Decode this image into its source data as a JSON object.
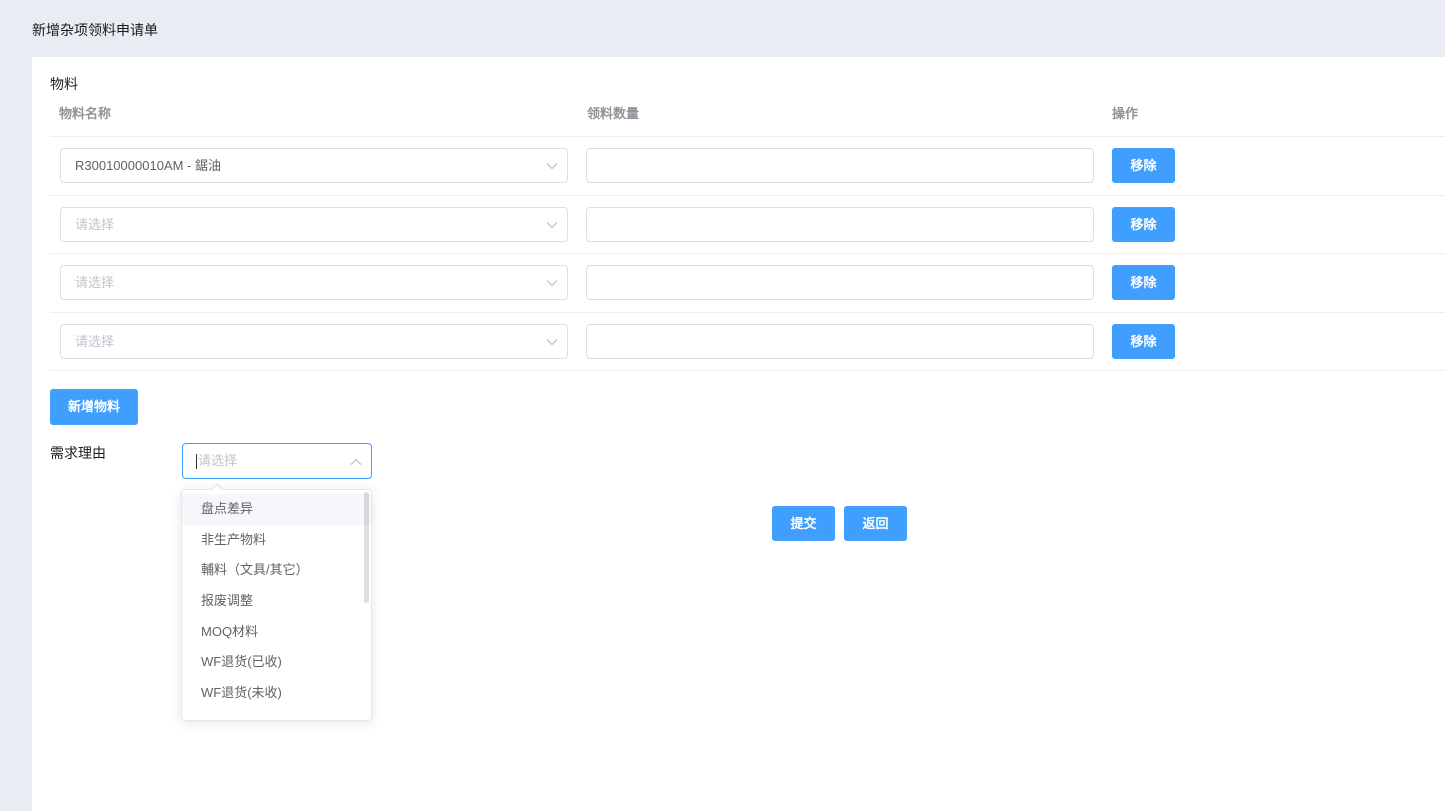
{
  "page": {
    "title": "新增杂项领料申请单"
  },
  "materials": {
    "section_label": "物料",
    "columns": {
      "name": "物料名称",
      "qty": "领料数量",
      "action": "操作"
    },
    "remove_label": "移除",
    "add_label": "新增物料",
    "rows": [
      {
        "name": "R30010000010AM - 鋸油",
        "qty": ""
      },
      {
        "name_placeholder": "请选择",
        "qty": ""
      },
      {
        "name_placeholder": "请选择",
        "qty": ""
      },
      {
        "name_placeholder": "请选择",
        "qty": ""
      }
    ]
  },
  "reason": {
    "label": "需求理由",
    "placeholder": "请选择",
    "open": true,
    "hovered_index": 0,
    "options": [
      "盘点差异",
      "非生产物料",
      "輔料（文具/其它）",
      "报废调整",
      "MOQ材料",
      "WF退货(已收)",
      "WF退货(未收)"
    ]
  },
  "actions": {
    "submit_label": "提交",
    "back_label": "返回"
  },
  "icons": {
    "select_closed": "chevron-down-icon",
    "select_open": "chevron-up-icon"
  },
  "colors": {
    "primary": "#409eff",
    "page_background": "#e9ecf3",
    "card_background": "#ffffff",
    "placeholder": "#c0c4cc",
    "header_text": "#909399",
    "option_hover": "#f5f7fa"
  }
}
